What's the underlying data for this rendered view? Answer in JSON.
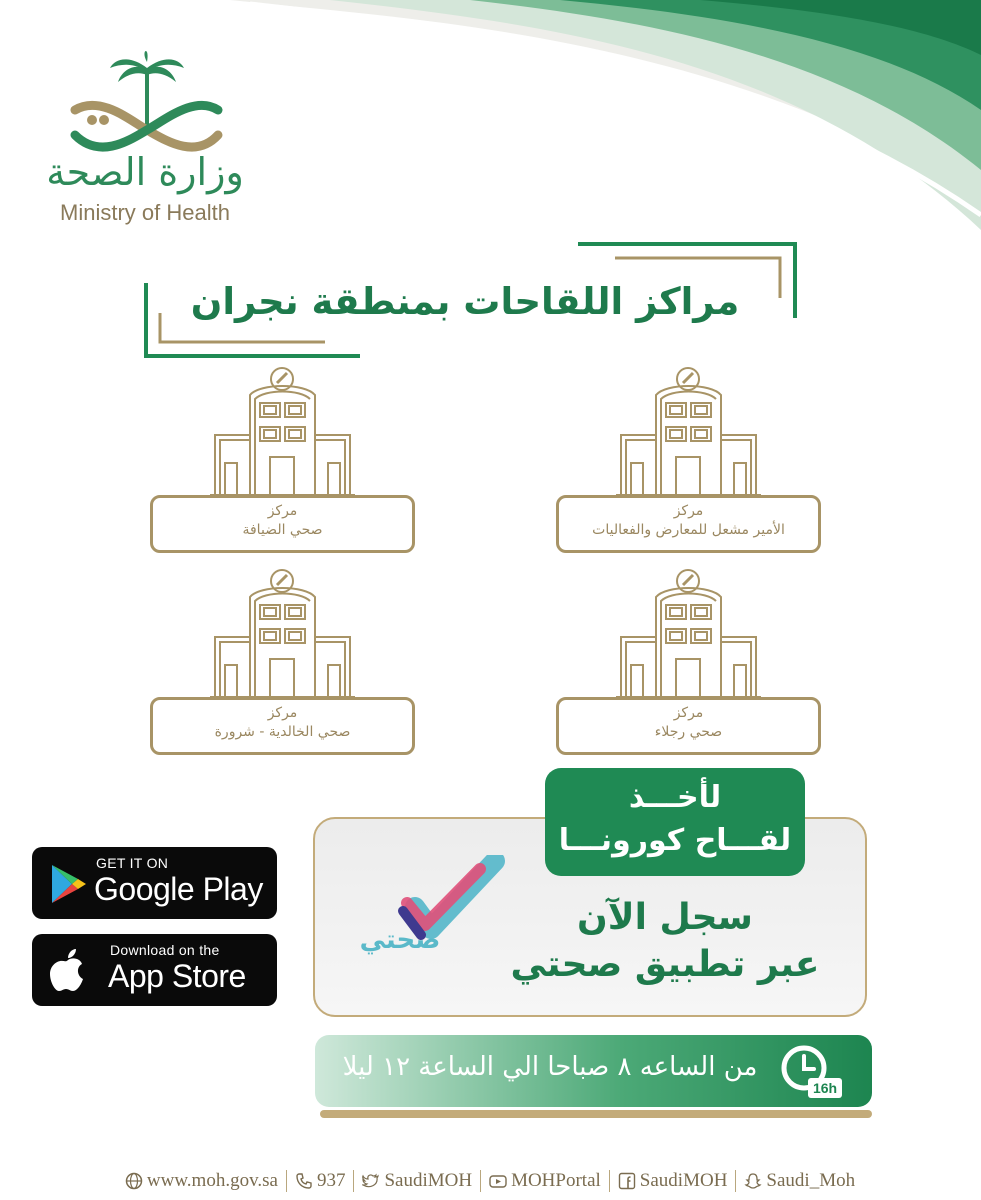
{
  "logo": {
    "arabic": "وزارة الصحة",
    "english": "Ministry of Health"
  },
  "title": "مراكز اللقاحات بمنطقة نجران",
  "centers": [
    {
      "line1": "مركز",
      "line2": "الأمير مشعل للمعارض والفعاليات"
    },
    {
      "line1": "مركز",
      "line2": "صحي الضيافة"
    },
    {
      "line1": "مركز",
      "line2": "صحي رجلاء"
    },
    {
      "line1": "مركز",
      "line2": "صحي الخالدية - شرورة"
    }
  ],
  "badges": {
    "google": {
      "small": "GET IT ON",
      "big": "Google Play"
    },
    "apple": {
      "small": "Download on the",
      "big": "App Store"
    }
  },
  "registration": {
    "pill_line1": "لأخـــذ",
    "pill_line2": "لقـــاح كورونـــا",
    "line1": "سجل الآن",
    "line2": "عبر تطبيق صحتي",
    "app_name": "صحتي"
  },
  "hours": {
    "text": "من الساعه ٨ صباحا الي الساعة ١٢ ليلا",
    "badge": "16h"
  },
  "footer": {
    "website": "www.moh.gov.sa",
    "phone": "937",
    "twitter": "SaudiMOH",
    "youtube": "MOHPortal",
    "facebook": "SaudiMOH",
    "snapchat": "Saudi_Moh"
  },
  "colors": {
    "green": "#1f8a54",
    "gold": "#a89466",
    "teal": "#5ab9c9"
  }
}
